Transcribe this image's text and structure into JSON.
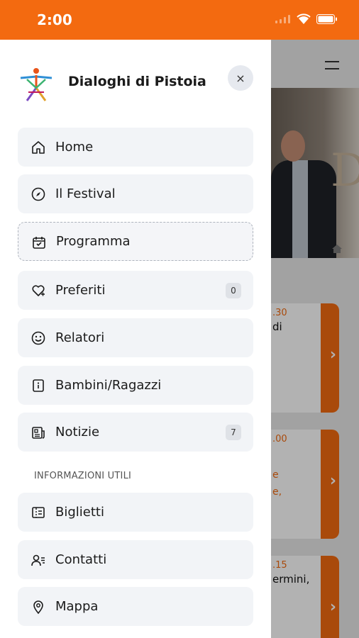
{
  "status_bar": {
    "time": "2:00",
    "icons": [
      "signal-icon",
      "wifi-icon",
      "battery-icon"
    ]
  },
  "header": {
    "title": "Dialoghi di Pistoia",
    "close_label": "×"
  },
  "menu": {
    "items": [
      {
        "icon": "home-icon",
        "label": "Home"
      },
      {
        "icon": "compass-icon",
        "label": "Il Festival"
      },
      {
        "icon": "calendar-icon",
        "label": "Programma"
      },
      {
        "icon": "heart-icon",
        "label": "Preferiti",
        "badge": "0"
      },
      {
        "icon": "smiley-icon",
        "label": "Relatori"
      },
      {
        "icon": "info-icon",
        "label": "Bambini/Ragazzi"
      },
      {
        "icon": "news-icon",
        "label": "Notizie",
        "badge": "7"
      }
    ],
    "section_title": "INFORMAZIONI UTILI",
    "info_items": [
      {
        "icon": "ticket-icon",
        "label": "Biglietti"
      },
      {
        "icon": "contacts-icon",
        "label": "Contatti"
      },
      {
        "icon": "map-pin-icon",
        "label": "Mappa"
      }
    ]
  },
  "background": {
    "photo_word": "Dia",
    "cards": [
      {
        "time": ".30",
        "line1": "di",
        "line2": "",
        "line3": ""
      },
      {
        "time": ".00",
        "line1": "",
        "line2": "e",
        "line3": "e,"
      },
      {
        "time": ".15",
        "line1": "ermini,",
        "line2": "",
        "line3": ""
      }
    ]
  },
  "colors": {
    "accent": "#F36A10",
    "item_bg": "#F2F4F7",
    "badge_bg": "#DFE2E7",
    "text": "#1b1b1b"
  }
}
